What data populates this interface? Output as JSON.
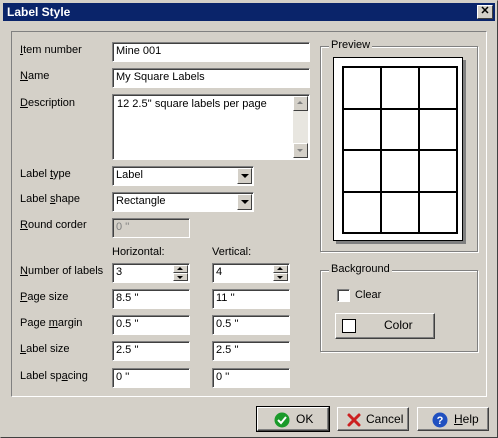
{
  "window": {
    "title": "Label Style",
    "close_glyph": "✕"
  },
  "fields": {
    "item_number": {
      "label_u": "I",
      "label_rest": "tem number",
      "value": "Mine 001"
    },
    "name": {
      "label_u": "N",
      "label_rest": "ame",
      "value": "My Square Labels"
    },
    "description": {
      "label_u": "D",
      "label_rest": "escription",
      "value": "12 2.5'' square labels per page"
    },
    "label_type": {
      "label_pre": "Label ",
      "label_u": "t",
      "label_rest": "ype",
      "value": "Label"
    },
    "label_shape": {
      "label_pre": "Label ",
      "label_u": "s",
      "label_rest": "hape",
      "value": "Rectangle"
    },
    "round_corder": {
      "label_u": "R",
      "label_rest": "ound corder",
      "value": "0 ''"
    }
  },
  "columns": {
    "horizontal": "Horizontal:",
    "vertical": "Vertical:"
  },
  "rows": {
    "number_of_labels": {
      "label_u": "N",
      "label_rest": "umber of labels",
      "h": "3",
      "v": "4"
    },
    "page_size": {
      "label_u": "P",
      "label_rest": "age size",
      "h": "8.5 ''",
      "v": "11 ''"
    },
    "page_margin": {
      "label_pre": "Page ",
      "label_u": "m",
      "label_rest": "argin",
      "h": "0.5 ''",
      "v": "0.5 ''"
    },
    "label_size": {
      "label_u": "L",
      "label_rest": "abel size",
      "h": "2.5 ''",
      "v": "2.5 ''"
    },
    "label_spacing": {
      "label_pre": "Label sp",
      "label_u": "a",
      "label_rest": "cing",
      "h": "0 ''",
      "v": "0 ''"
    }
  },
  "preview": {
    "title": "Preview",
    "grid": {
      "cols": 3,
      "rows": 4
    }
  },
  "background": {
    "title": "Background",
    "clear_label": "Clear",
    "clear_checked": false,
    "color_label": "Color",
    "swatch_color": "#ffffff"
  },
  "buttons": {
    "ok": {
      "label": "OK",
      "icon": "check-icon",
      "color": "#1a9a2a"
    },
    "cancel": {
      "label": "Cancel",
      "icon": "x-icon",
      "color": "#cc2020"
    },
    "help": {
      "label_u": "H",
      "label_rest": "elp",
      "icon": "help-icon",
      "color": "#2050c0"
    }
  }
}
